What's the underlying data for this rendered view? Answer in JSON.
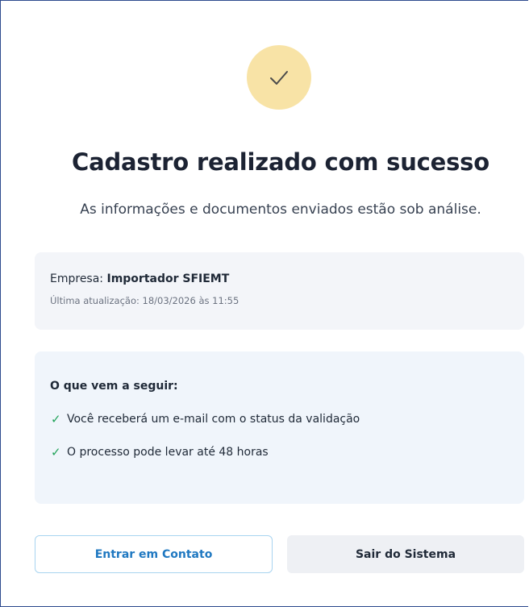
{
  "header": {
    "title": "Cadastro realizado com sucesso",
    "subtitle": "As informações e documentos enviados estão sob análise."
  },
  "status_icon": {
    "name": "checkmark-icon",
    "background_color": "#f8e3a6",
    "stroke_color": "#4b4b4b"
  },
  "info": {
    "company_label": "Empresa:",
    "company_name": "Importador SFIEMT",
    "updated_label": "Última atualização: 18/03/2026 às 11:55"
  },
  "next_steps": {
    "title": "O que vem a seguir:",
    "items": [
      "Você receberá um e-mail com o status da validação",
      "O processo pode levar até 48 horas"
    ],
    "check_color": "#22a35a"
  },
  "actions": {
    "contact_label": "Entrar em Contato",
    "exit_label": "Sair do Sistema"
  }
}
